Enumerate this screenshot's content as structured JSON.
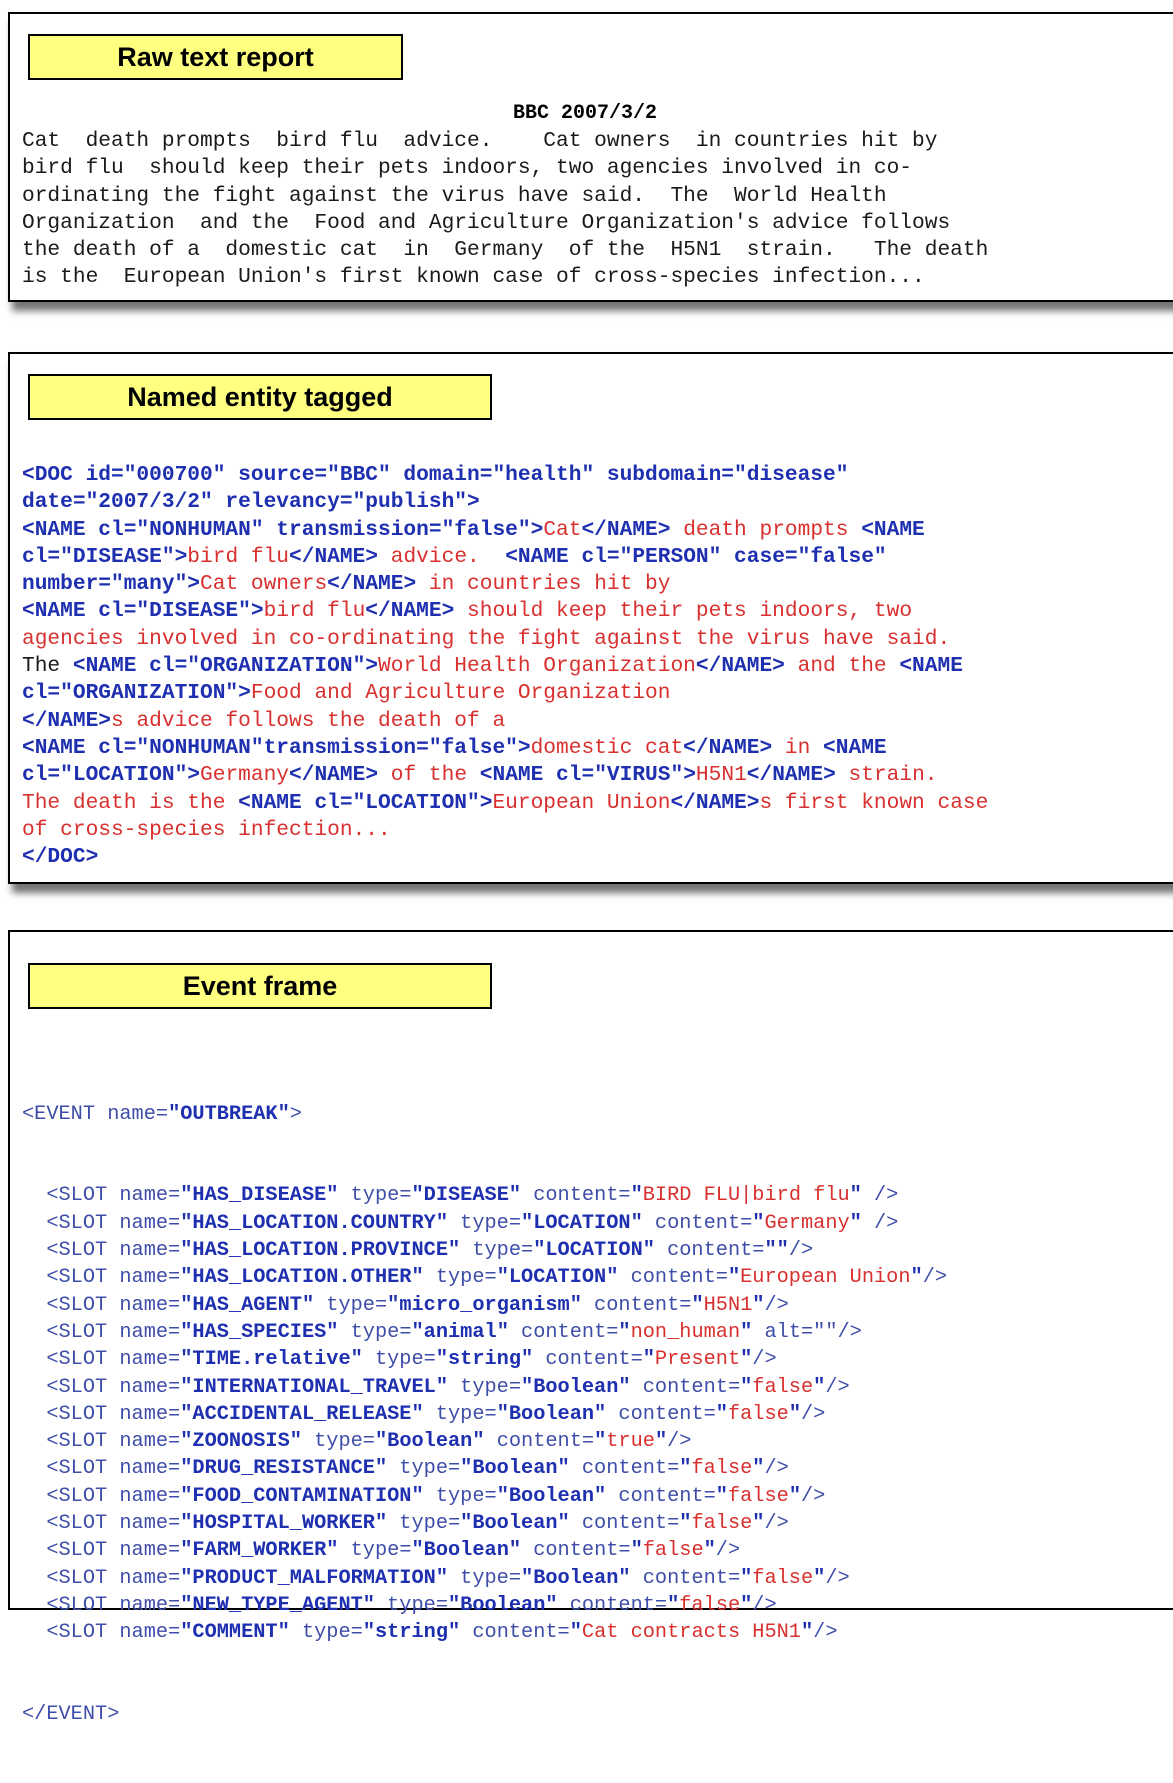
{
  "raw": {
    "label": "Raw text report",
    "date_line": "BBC 2007/3/2",
    "lines": [
      "Cat  death prompts  bird flu  advice.    Cat owners  in countries hit by",
      "bird flu  should keep their pets indoors, two agencies involved in co-",
      "ordinating the fight against the virus have said.  The  World Health",
      "Organization  and the  Food and Agriculture Organization's advice follows",
      "the death of a  domestic cat  in  Germany  of the  H5N1  strain.   The death",
      "is the  European Union's first known case of cross-species infection..."
    ]
  },
  "ne": {
    "label": "Named entity tagged",
    "lines": [
      [
        {
          "t": "tag",
          "s": "<DOC id=\"000700\" source=\"BBC\" domain=\"health\" subdomain=\"disease\""
        }
      ],
      [
        {
          "t": "tag",
          "s": "date=\"2007/3/2\" relevancy=\"publish\">"
        }
      ],
      [
        {
          "t": "tag",
          "s": "<NAME cl=\"NONHUMAN\" transmission=\"false\">"
        },
        {
          "t": "ent",
          "s": "Cat"
        },
        {
          "t": "tag",
          "s": "</NAME>"
        },
        {
          "t": "ent",
          "s": " death prompts "
        },
        {
          "t": "tag",
          "s": "<NAME"
        }
      ],
      [
        {
          "t": "tag",
          "s": "cl=\"DISEASE\">"
        },
        {
          "t": "ent",
          "s": "bird flu"
        },
        {
          "t": "tag",
          "s": "</NAME>"
        },
        {
          "t": "ent",
          "s": " advice.  "
        },
        {
          "t": "tag",
          "s": "<NAME cl=\"PERSON\" case=\"false\""
        }
      ],
      [
        {
          "t": "tag",
          "s": "number=\"many\">"
        },
        {
          "t": "ent",
          "s": "Cat owners"
        },
        {
          "t": "tag",
          "s": "</NAME>"
        },
        {
          "t": "ent",
          "s": " in countries hit by"
        }
      ],
      [
        {
          "t": "tag",
          "s": "<NAME cl=\"DISEASE\">"
        },
        {
          "t": "ent",
          "s": "bird flu"
        },
        {
          "t": "tag",
          "s": "</NAME>"
        },
        {
          "t": "ent",
          "s": " should keep their pets indoors, two"
        }
      ],
      [
        {
          "t": "ent",
          "s": "agencies involved in co-ordinating the fight against the virus have said."
        }
      ],
      [
        {
          "t": "blk",
          "s": "The "
        },
        {
          "t": "tag",
          "s": "<NAME cl=\"ORGANIZATION\">"
        },
        {
          "t": "ent",
          "s": "World Health Organization"
        },
        {
          "t": "tag",
          "s": "</NAME>"
        },
        {
          "t": "ent",
          "s": " and the "
        },
        {
          "t": "tag",
          "s": "<NAME"
        }
      ],
      [
        {
          "t": "tag",
          "s": "cl=\"ORGANIZATION\">"
        },
        {
          "t": "ent",
          "s": "Food and Agriculture Organization"
        }
      ],
      [
        {
          "t": "tag",
          "s": "</NAME>"
        },
        {
          "t": "ent",
          "s": "s advice follows the death of a"
        }
      ],
      [
        {
          "t": "tag",
          "s": "<NAME cl=\"NONHUMAN\"transmission=\"false\">"
        },
        {
          "t": "ent",
          "s": "domestic cat"
        },
        {
          "t": "tag",
          "s": "</NAME>"
        },
        {
          "t": "ent",
          "s": " in "
        },
        {
          "t": "tag",
          "s": "<NAME"
        }
      ],
      [
        {
          "t": "tag",
          "s": "cl=\"LOCATION\">"
        },
        {
          "t": "ent",
          "s": "Germany"
        },
        {
          "t": "tag",
          "s": "</NAME>"
        },
        {
          "t": "ent",
          "s": " of the "
        },
        {
          "t": "tag",
          "s": "<NAME cl=\"VIRUS\">"
        },
        {
          "t": "ent",
          "s": "H5N1"
        },
        {
          "t": "tag",
          "s": "</NAME>"
        },
        {
          "t": "ent",
          "s": " strain."
        }
      ],
      [
        {
          "t": "ent",
          "s": "The death is the "
        },
        {
          "t": "tag",
          "s": "<NAME cl=\"LOCATION\">"
        },
        {
          "t": "ent",
          "s": "European Union"
        },
        {
          "t": "tag",
          "s": "</NAME>"
        },
        {
          "t": "ent",
          "s": "s first known case"
        }
      ],
      [
        {
          "t": "ent",
          "s": "of cross-species infection..."
        }
      ],
      [
        {
          "t": "tag",
          "s": "</DOC>"
        }
      ]
    ]
  },
  "event": {
    "label": "Event frame",
    "open": "<EVENT name=",
    "event_name": "\"OUTBREAK\"",
    "open_end": ">",
    "close": "</EVENT>",
    "slots": [
      {
        "name": "HAS_DISEASE",
        "type": "DISEASE",
        "content": "BIRD FLU|bird flu",
        "extra": "",
        "end": " />",
        "bool": false
      },
      {
        "name": "HAS_LOCATION.COUNTRY",
        "type": "LOCATION",
        "content": "Germany",
        "extra": "",
        "end": " />",
        "bool": false
      },
      {
        "name": "HAS_LOCATION.PROVINCE",
        "type": "LOCATION",
        "content": "",
        "extra": "",
        "end": "/>",
        "bool": false
      },
      {
        "name": "HAS_LOCATION.OTHER",
        "type": "LOCATION",
        "content": "European Union",
        "extra": "",
        "end": "/>",
        "bool": false
      },
      {
        "name": "HAS_AGENT",
        "type": "micro_organism",
        "content": "H5N1",
        "extra": "",
        "end": "/>",
        "bool": false
      },
      {
        "name": "HAS_SPECIES",
        "type": "animal",
        "content": "non_human",
        "extra": " alt=\"\"",
        "end": "/>",
        "bool": false
      },
      {
        "name": "TIME.relative",
        "type": "string",
        "content": "Present",
        "extra": "",
        "end": "/>",
        "bool": false
      },
      {
        "name": "INTERNATIONAL_TRAVEL",
        "type": "Boolean",
        "content": "false",
        "extra": "",
        "end": "/>",
        "bool": true
      },
      {
        "name": "ACCIDENTAL_RELEASE",
        "type": "Boolean",
        "content": "false",
        "extra": "",
        "end": "/>",
        "bool": true
      },
      {
        "name": "ZOONOSIS",
        "type": "Boolean",
        "content": "true",
        "extra": "",
        "end": "/>",
        "bool": true
      },
      {
        "name": "DRUG_RESISTANCE",
        "type": "Boolean",
        "content": "false",
        "extra": "",
        "end": "/>",
        "bool": true
      },
      {
        "name": "FOOD_CONTAMINATION",
        "type": "Boolean",
        "content": "false",
        "extra": "",
        "end": "/>",
        "bool": true
      },
      {
        "name": "HOSPITAL_WORKER",
        "type": "Boolean",
        "content": "false",
        "extra": "",
        "end": "/>",
        "bool": true
      },
      {
        "name": "FARM_WORKER",
        "type": "Boolean",
        "content": "false",
        "extra": "",
        "end": "/>",
        "bool": true
      },
      {
        "name": "PRODUCT_MALFORMATION",
        "type": "Boolean",
        "content": "false",
        "extra": "",
        "end": "/>",
        "bool": true
      },
      {
        "name": "NEW_TYPE_AGENT",
        "type": "Boolean",
        "content": "false",
        "extra": "",
        "end": "/>",
        "bool": true
      },
      {
        "name": "COMMENT",
        "type": "string",
        "content": "Cat contracts H5N1",
        "extra": "",
        "end": "/>",
        "bool": false
      }
    ]
  },
  "colors": {
    "label_fill": "#ffff80",
    "tag_blue": "#1e2fb0",
    "entity_red": "#d8302e"
  }
}
